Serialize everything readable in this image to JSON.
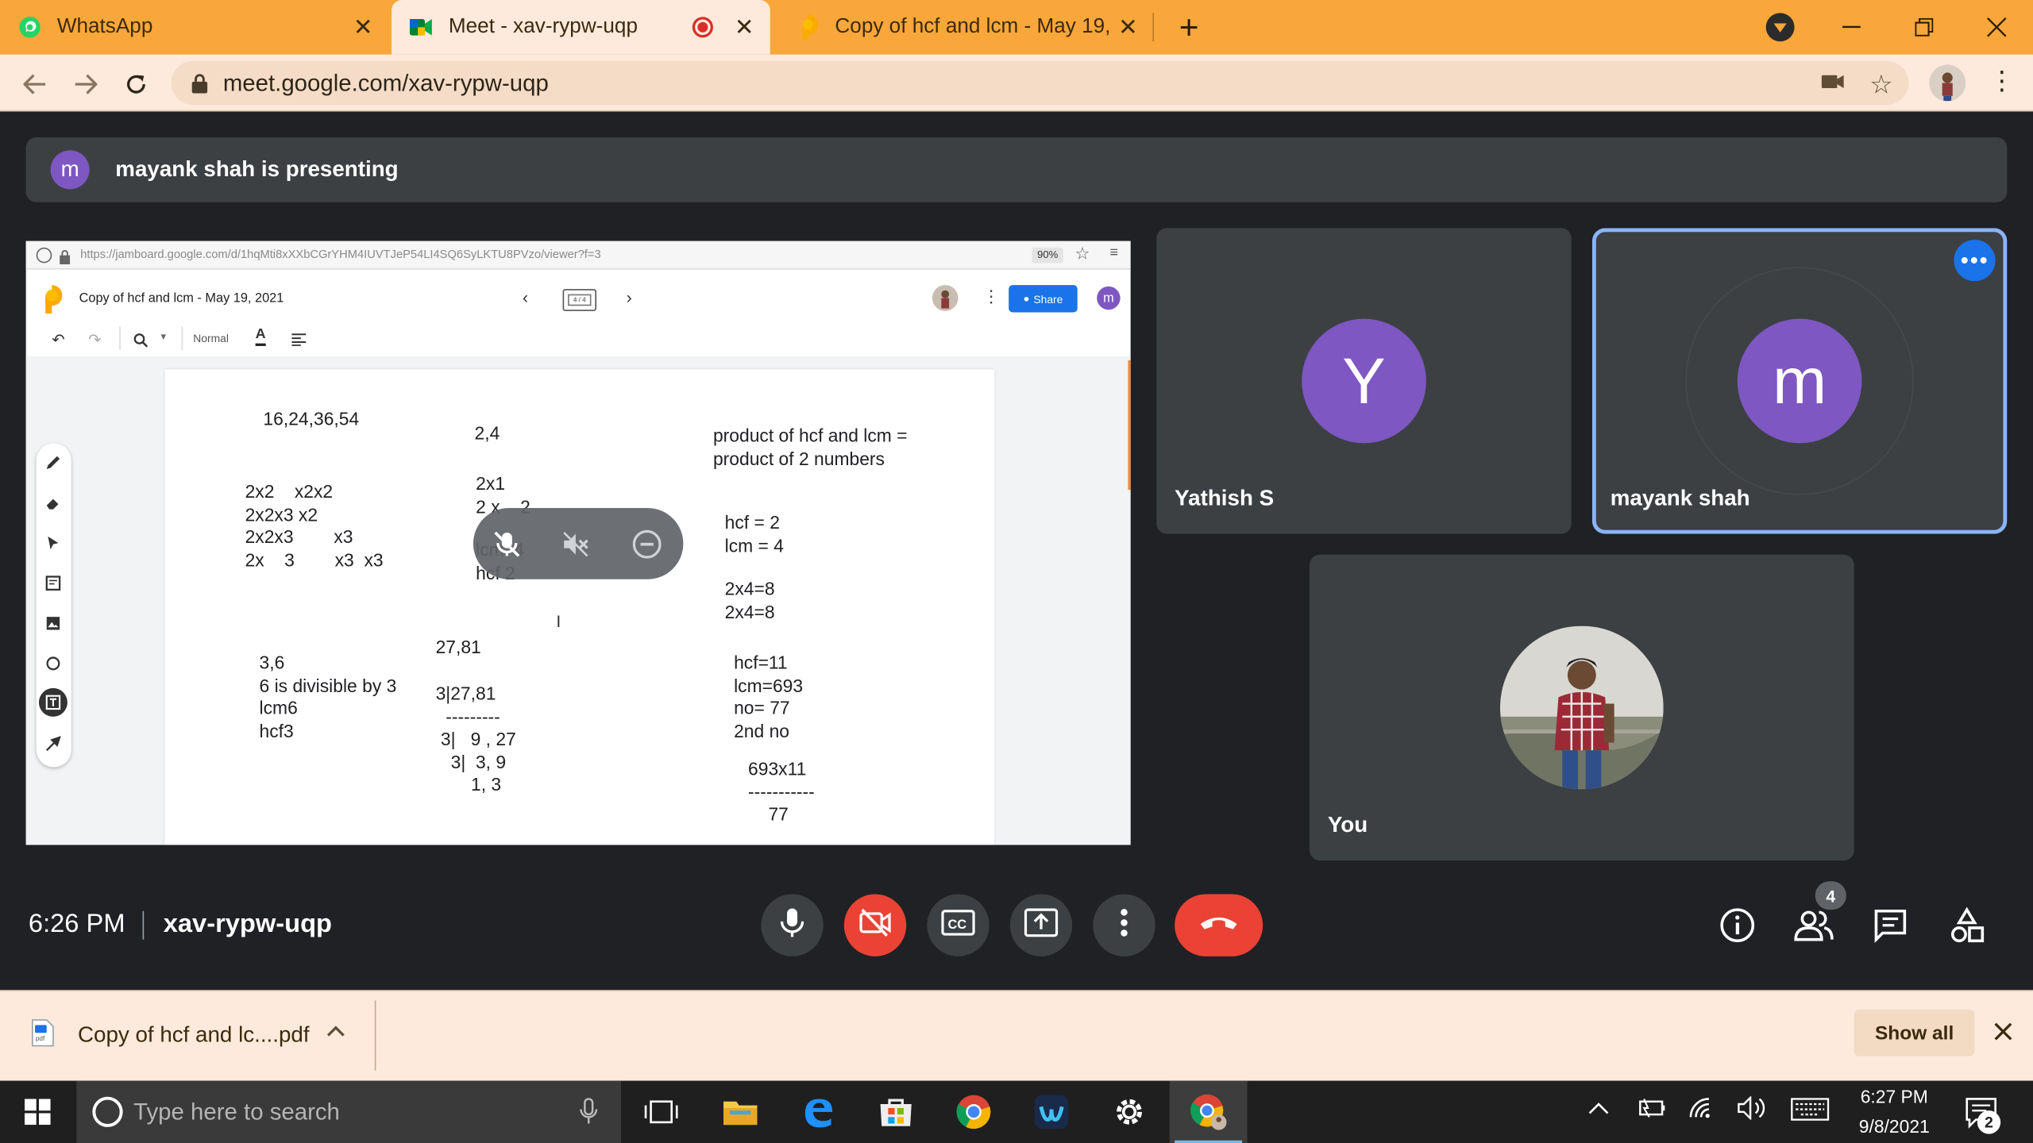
{
  "browser": {
    "tabs": [
      {
        "title": "WhatsApp"
      },
      {
        "title": "Meet - xav-rypw-uqp"
      },
      {
        "title": "Copy of hcf and lcm - May 19, 20"
      }
    ],
    "url": "meet.google.com/xav-rypw-uqp"
  },
  "meet": {
    "presenter_initial": "m",
    "presenting_text": "mayank shah is presenting",
    "participants": [
      {
        "initial": "Y",
        "name": "Yathish S"
      },
      {
        "initial": "m",
        "name": "mayank shah"
      },
      {
        "name": "You"
      }
    ],
    "time": "6:26 PM",
    "meeting_code": "xav-rypw-uqp",
    "people_count": "4"
  },
  "jamboard": {
    "url": "https://jamboard.google.com/d/1hqMti8xXXbCGrYHM4IUVTJeP54LI4SQ6SyLKTU8PVzo/viewer?f=3",
    "zoom": "90%",
    "title": "Copy of hcf and lcm - May 19, 2021",
    "page_indicator": "4 / 4",
    "share_label": "Share",
    "user_initial": "m",
    "font_style": "Normal",
    "notes": {
      "n1": "16,24,36,54",
      "n2": "2x2    x2x2\n2x2x3 x2\n2x2x3        x3\n2x    3        x3  x3",
      "n3": "2,4",
      "n4": "2x1\n2 x    2",
      "n5": "lcm  4\nhcf 2",
      "n6": "product of hcf and lcm =\nproduct of 2 numbers",
      "n7": "hcf = 2\nlcm = 4",
      "n8": "2x4=8\n2x4=8",
      "n9": "3,6\n6 is divisible by 3\nlcm6\nhcf3",
      "n10": "27,81",
      "n11": "3|27,81\n  ---------\n 3|   9 , 27\n   3|  3, 9\n       1, 3",
      "n12": "hcf=11\nlcm=693\nno= 77\n2nd no",
      "n13": "693x11\n-----------\n    77"
    }
  },
  "download": {
    "filename": "Copy of hcf and lc....pdf",
    "show_all": "Show all"
  },
  "taskbar": {
    "search_placeholder": "Type here to search",
    "time": "6:27 PM",
    "date": "9/8/2021",
    "notification_count": "2"
  },
  "colors": {
    "tab_strip": "#f9a73a",
    "tab_active": "#fdeadc",
    "meet_bg": "#202124",
    "tile_bg": "#3c4043",
    "end_call": "#ea4335",
    "active_speaker": "#8ab4f8",
    "avatar_purple": "#7e57c2"
  }
}
